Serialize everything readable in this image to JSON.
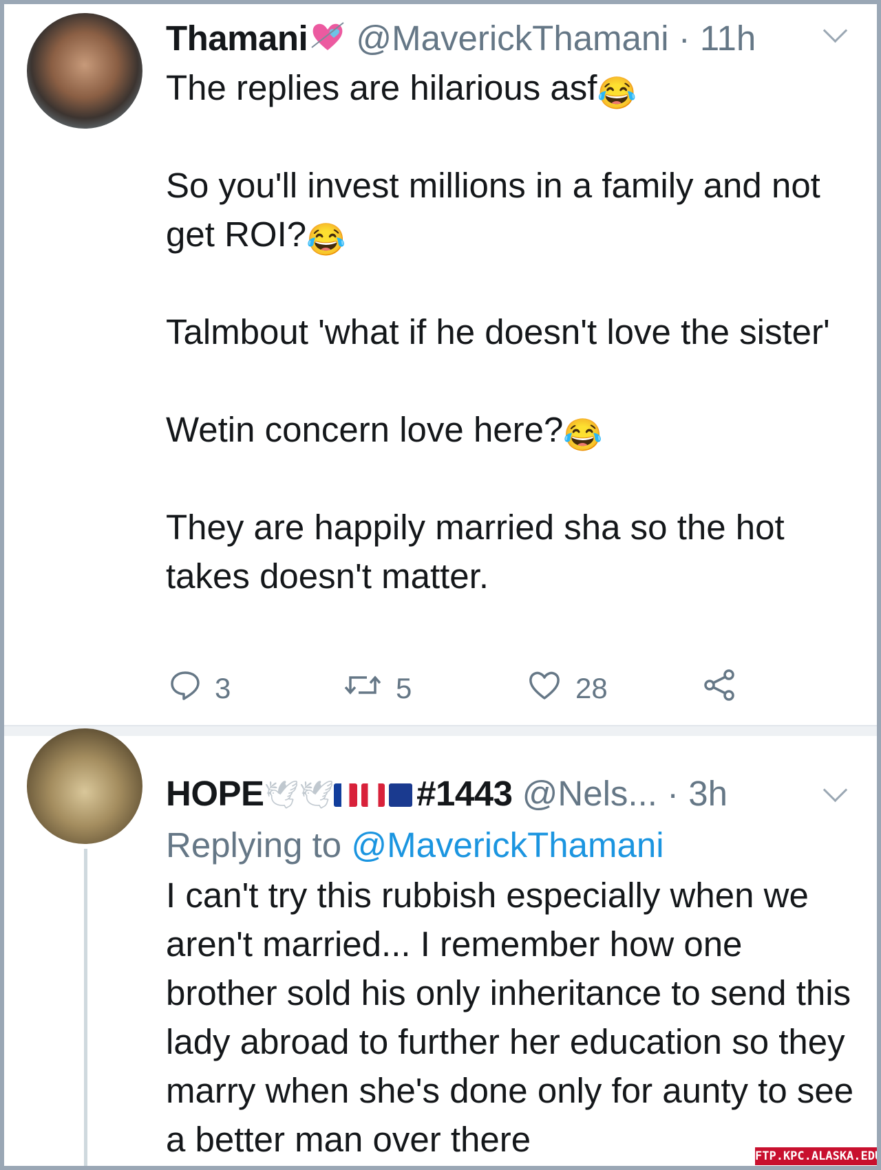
{
  "tweets": [
    {
      "display_name": "Thamani",
      "handle": "@MaverickThamani",
      "time": "· 11h",
      "paragraphs": [
        "The replies are hilarious asf",
        "So you'll invest millions in a family and not get ROI?",
        "Talmbout 'what if he doesn't love the sister'",
        "Wetin concern love here?",
        "They are happily married sha so the hot takes doesn't matter."
      ],
      "stats": {
        "replies": "3",
        "retweets": "5",
        "likes": "28"
      }
    },
    {
      "display_name": "HOPE",
      "name_suffix": "#1443",
      "handle": "@Nels...",
      "time": "· 3h",
      "replying_label": "Replying to",
      "replying_handle": "@MaverickThamani",
      "text": "I can't try this rubbish especially when we aren't married... I remember how one brother sold his only inheritance to send this lady abroad to further her education so they marry when she's done only for aunty to see a better man over there"
    }
  ],
  "watermark": "FTP.KPC.ALASKA.EDU",
  "icons": [
    "heart-with-arrow-icon",
    "laughing-emoji-icon",
    "dove-icon",
    "france-flag-icon",
    "canada-flag-icon",
    "australia-flag-icon",
    "reply-icon",
    "retweet-icon",
    "like-icon",
    "share-icon",
    "chevron-down-icon"
  ],
  "colors": {
    "link": "#1b95e0",
    "muted": "#657786",
    "text": "#14171a"
  }
}
